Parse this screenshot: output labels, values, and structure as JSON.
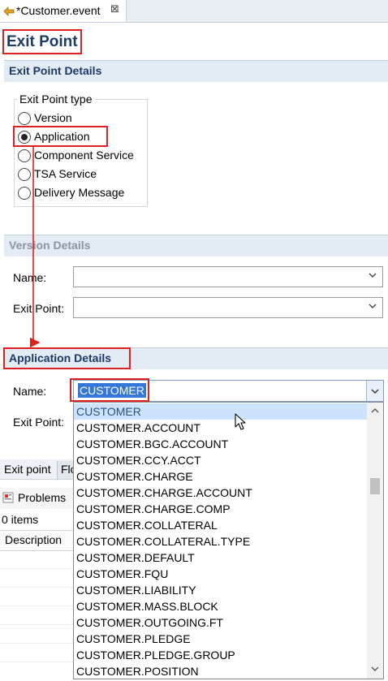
{
  "editor_tab": {
    "title": "*Customer.event",
    "close": "⊠"
  },
  "page_title": "Exit Point",
  "exit_point_details": {
    "header": "Exit Point Details",
    "group_label": "Exit Point type",
    "options": [
      "Version",
      "Application",
      "Component Service",
      "TSA Service",
      "Delivery Message"
    ],
    "selected": "Application"
  },
  "version_details": {
    "header": "Version Details",
    "name_label": "Name:",
    "name_value": "",
    "exit_point_label": "Exit Point:",
    "exit_point_value": ""
  },
  "application_details": {
    "header": "Application Details",
    "name_label": "Name:",
    "name_value": "CUSTOMER",
    "exit_point_label": "Exit Point:"
  },
  "dropdown_items": [
    "CUSTOMER",
    "CUSTOMER.ACCOUNT",
    "CUSTOMER.BGC.ACCOUNT",
    "CUSTOMER.CCY.ACCT",
    "CUSTOMER.CHARGE",
    "CUSTOMER.CHARGE.ACCOUNT",
    "CUSTOMER.CHARGE.COMP",
    "CUSTOMER.COLLATERAL",
    "CUSTOMER.COLLATERAL.TYPE",
    "CUSTOMER.DEFAULT",
    "CUSTOMER.FQU",
    "CUSTOMER.LIABILITY",
    "CUSTOMER.MASS.BLOCK",
    "CUSTOMER.OUTGOING.FT",
    "CUSTOMER.PLEDGE",
    "CUSTOMER.PLEDGE.GROUP",
    "CUSTOMER.POSITION"
  ],
  "dropdown_selected_index": 0,
  "bottom_tabs": {
    "exit_point": "Exit point",
    "flow": "Flo"
  },
  "problems": {
    "title": "Problems",
    "count": "0 items",
    "column": "Description"
  },
  "colors": {
    "highlight": "#e02020",
    "header_text": "#1c3a66",
    "selection": "#3377d8"
  }
}
